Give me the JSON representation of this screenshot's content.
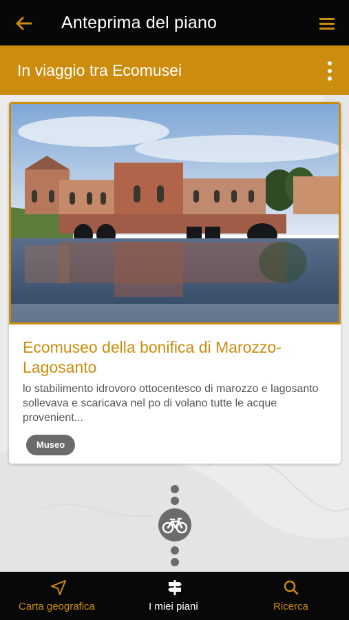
{
  "topbar": {
    "title": "Anteprima del piano",
    "back_icon": "arrow-left-icon",
    "menu_icon": "hamburger-menu-icon"
  },
  "plan": {
    "title": "In viaggio tra Ecomusei",
    "more_icon": "more-vertical-icon"
  },
  "card": {
    "image_alt": "Ecomuseo della bonifica di Marozzo-Lagosanto",
    "title": "Ecomuseo della bonifica di Marozzo-Lagosanto",
    "description": "lo stabilimento idrovoro ottocentesco di marozzo e lagosanto sollevava e scaricava nel po di volano tutte le acque provenient...",
    "tag": "Museo"
  },
  "timeline": {
    "transport_icon": "bicycle-icon"
  },
  "bottom_nav": {
    "items": [
      {
        "label": "Carta geografica",
        "icon": "navigation-arrow-icon",
        "active": false
      },
      {
        "label": "I miei piani",
        "icon": "signpost-icon",
        "active": true
      },
      {
        "label": "Ricerca",
        "icon": "search-icon",
        "active": false
      }
    ]
  },
  "colors": {
    "accent": "#cc8c0d",
    "topbar": "#070707",
    "tag_bg": "#6b6b6b",
    "nav_active": "#ffffff",
    "nav_inactive": "#cc8c0d"
  }
}
